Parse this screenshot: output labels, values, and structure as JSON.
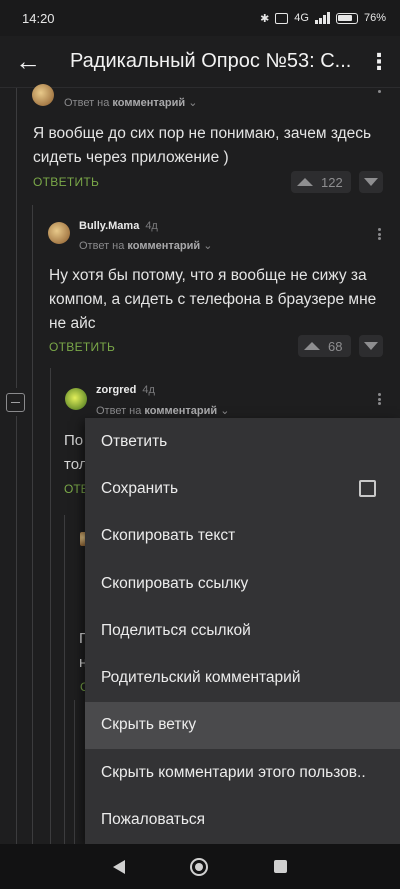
{
  "status_bar": {
    "time": "14:20",
    "network": "4G",
    "battery": "76%"
  },
  "header": {
    "title": "Радикальный Опрос №53: С..."
  },
  "comments": [
    {
      "author": "",
      "age": "",
      "reply_prefix": "Ответ на",
      "reply_target": "комментарий",
      "text": "Я вообще до сих пор не понимаю, зачем здесь сидеть через приложение )",
      "reply_label": "ОТВЕТИТЬ",
      "votes": "122"
    },
    {
      "author": "Bully.Mama",
      "age": "4д",
      "reply_prefix": "Ответ на",
      "reply_target": "комментарий",
      "text": "Ну хотя бы потому, что я вообще не сижу за компом, а сидеть с телефона в браузере мне не айс",
      "reply_label": "ОТВЕТИТЬ",
      "votes": "68"
    },
    {
      "author": "zorgred",
      "age": "4д",
      "reply_prefix": "Ответ на",
      "reply_target": "комментарий",
      "text_peek_1": "По",
      "text_peek_2": "тол",
      "reply_peek": "ОТВ"
    }
  ],
  "hidden_peeks": [
    "П",
    "н",
    "С"
  ],
  "menu": {
    "items": [
      "Ответить",
      "Сохранить",
      "Скопировать текст",
      "Скопировать ссылку",
      "Поделиться ссылкой",
      "Родительский комментарий",
      "Скрыть ветку",
      "Скрыть комментарии этого пользов..",
      "Пожаловаться"
    ],
    "save_checked": false,
    "highlighted_index": 6
  }
}
